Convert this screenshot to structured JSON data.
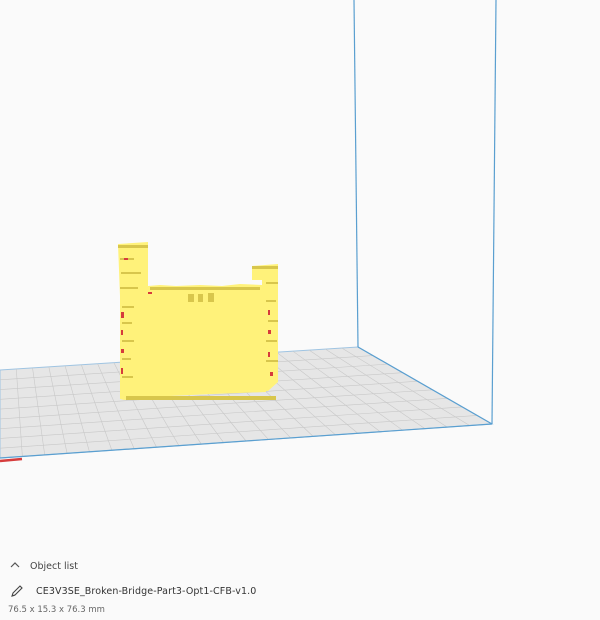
{
  "object_list": {
    "header_label": "Object list",
    "collapse_icon": "chevron-up-icon",
    "edit_icon": "pencil-icon",
    "object_name": "CE3V3SE_Broken-Bridge-Part3-Opt1-CFB-v1.0",
    "dimensions": "76.5 x 15.3 x 76.3 mm"
  },
  "colors": {
    "background": "#fafafa",
    "build_volume_edge": "#5a9fd0",
    "build_plate": "#e6e6e6",
    "grid_line": "#c8c8c8",
    "model_fill": "#fff27a",
    "model_shadow": "#d8c64c",
    "model_edge_red": "#d63c3c"
  }
}
